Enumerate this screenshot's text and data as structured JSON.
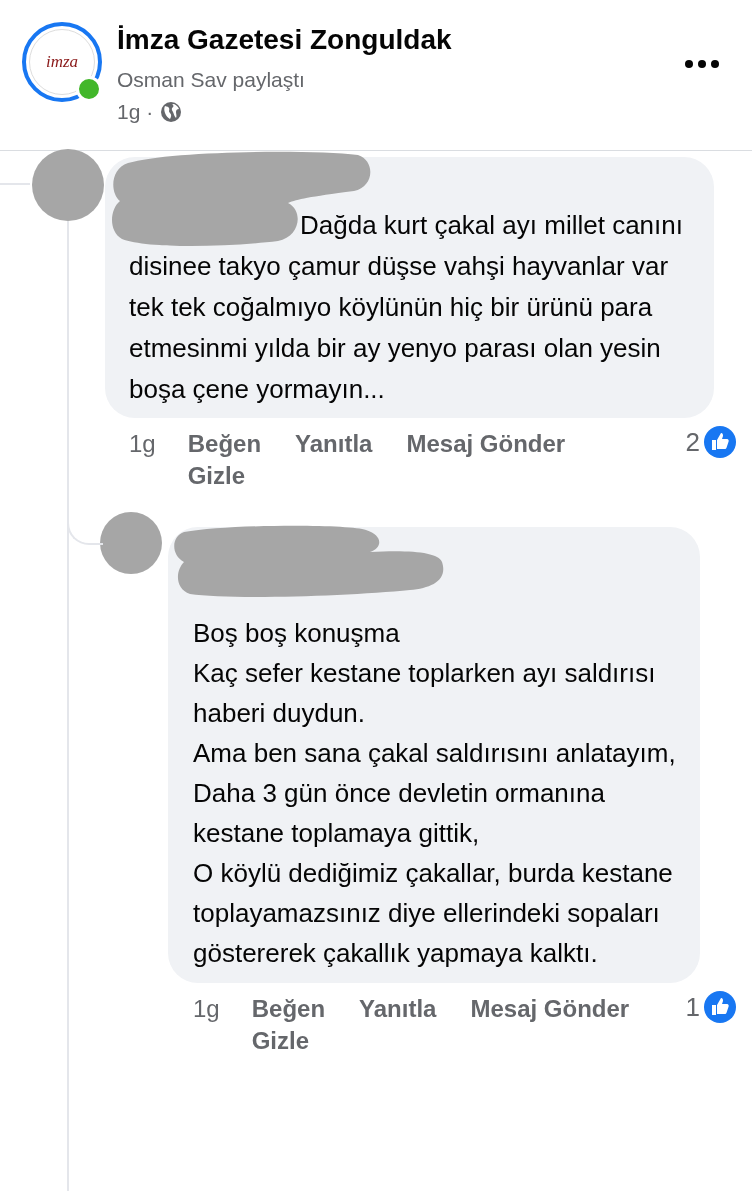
{
  "post": {
    "page_name": "İmza Gazetesi Zonguldak",
    "logo_text": "imza",
    "online": true,
    "shared_by": "Osman Sav paylaştı",
    "time": "1g",
    "separator": "·"
  },
  "comments": [
    {
      "text": "Dağda kurt çakal ayı millet canını disinee takyo çamur düşse vahşi hayvanlar var tek tek coğalmıyo köylünün hiç bir ürünü para etmesinmi yılda bir ay yenyo parası olan yesin boşa çene yormayın...",
      "time": "1g",
      "actions": [
        "Beğen",
        "Yanıtla",
        "Mesaj Gönder",
        "Gizle"
      ],
      "reaction_count": "2",
      "children": [
        {
          "text": "Boş boş konuşma\nKaç sefer kestane toplarken ayı saldırısı haberi duydun.\nAma ben sana çakal saldırısını anlatayım,\nDaha 3 gün önce devletin ormanına kestane toplamaya gittik,\nO köylü dediğimiz çakallar, burda kestane toplayamazsınız diye ellerindeki sopaları göstererek çakallık yapmaya kalktı.",
          "time": "1g",
          "actions": [
            "Beğen",
            "Yanıtla",
            "Mesaj Gönder",
            "Gizle"
          ],
          "reaction_count": "1"
        }
      ]
    }
  ]
}
